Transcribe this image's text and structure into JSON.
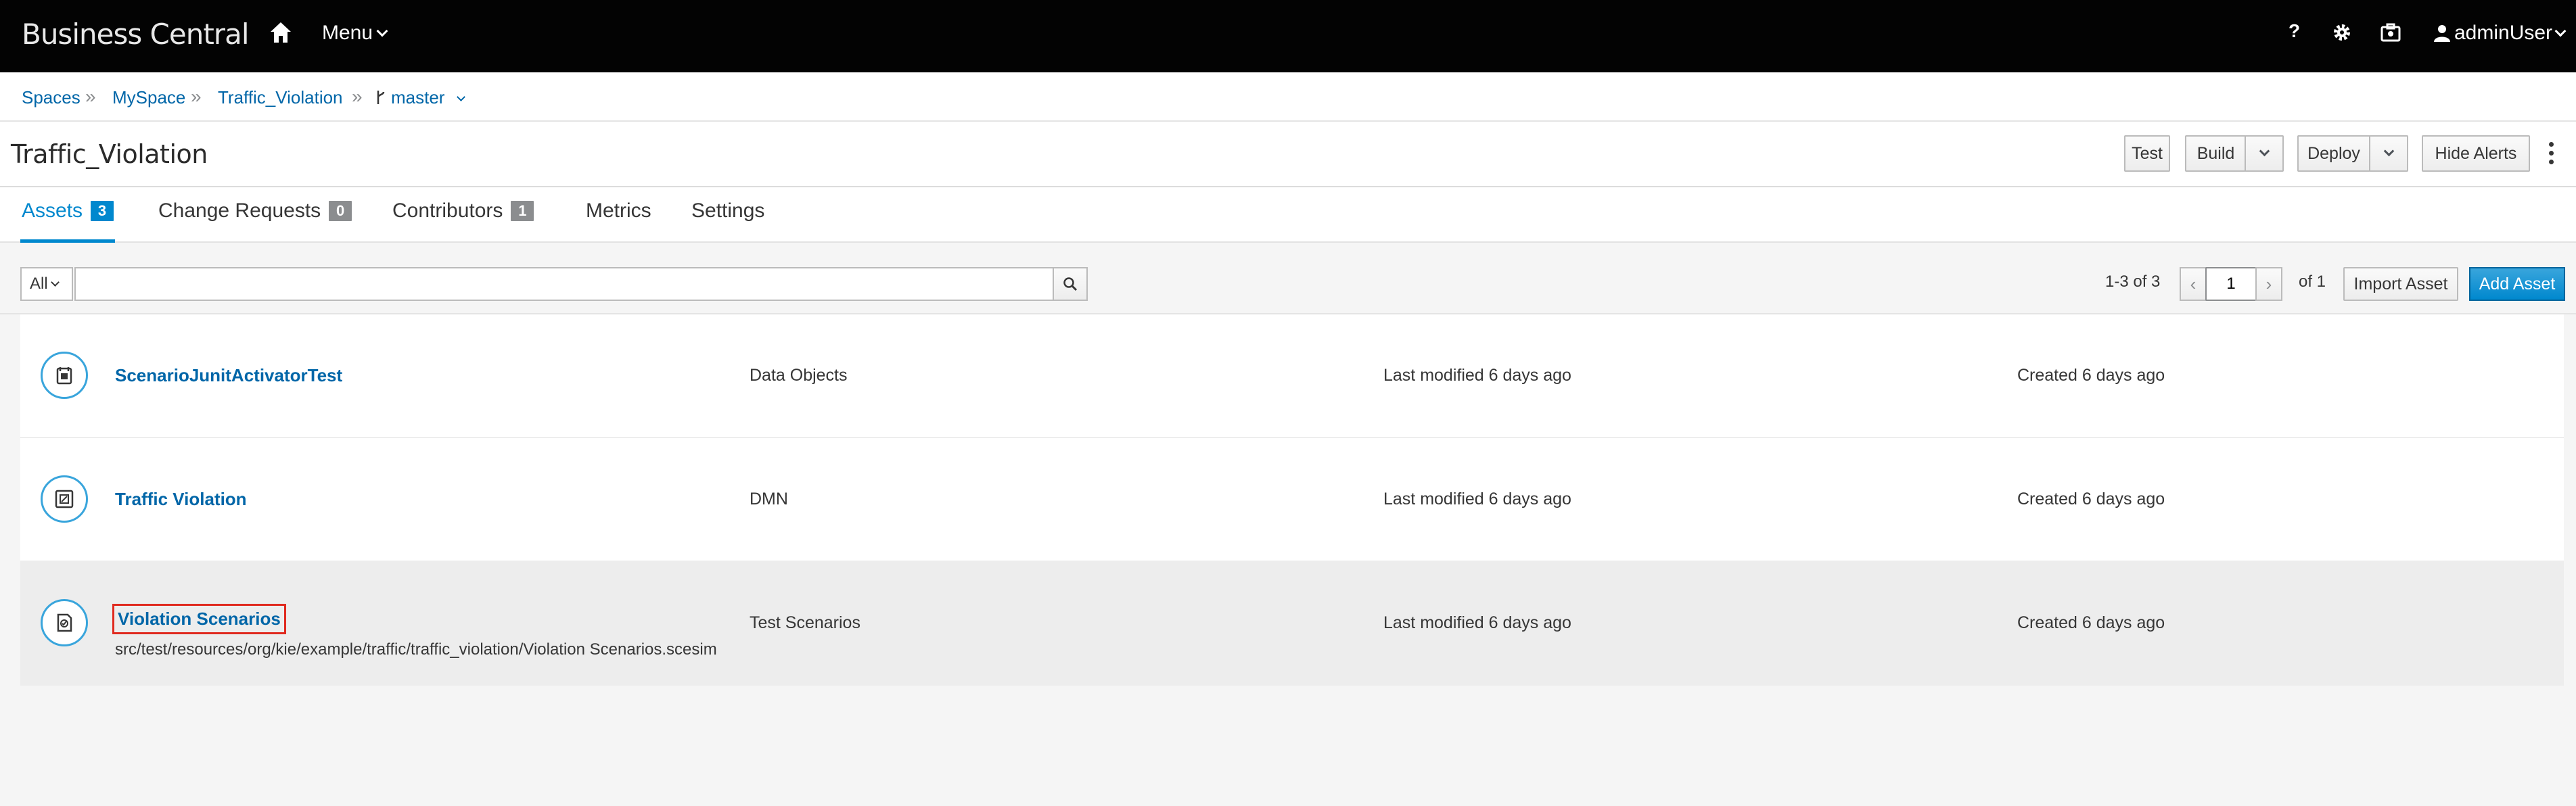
{
  "app": {
    "brand": "Business Central",
    "menu_label": "Menu",
    "help_label": "?",
    "user_label": "adminUser"
  },
  "breadcrumb": {
    "items": [
      "Spaces",
      "MySpace",
      "Traffic_Violation"
    ],
    "branch": "master"
  },
  "project": {
    "title": "Traffic_Violation",
    "buttons": {
      "test": "Test",
      "build": "Build",
      "deploy": "Deploy",
      "hide_alerts": "Hide Alerts"
    }
  },
  "tabs": [
    {
      "label": "Assets",
      "count": "3",
      "active": true
    },
    {
      "label": "Change Requests",
      "count": "0"
    },
    {
      "label": "Contributors",
      "count": "1"
    },
    {
      "label": "Metrics"
    },
    {
      "label": "Settings"
    }
  ],
  "toolbar": {
    "filter_value": "All",
    "search_value": "",
    "pager_count": "1-3 of 3",
    "page_value": "1",
    "page_of": "of 1",
    "import_label": "Import Asset",
    "add_label": "Add Asset"
  },
  "assets": [
    {
      "name": "ScenarioJunitActivatorTest",
      "type": "Data Objects",
      "modified": "Last modified 6 days ago",
      "created": "Created 6 days ago",
      "icon": "data-object-icon"
    },
    {
      "name": "Traffic Violation",
      "type": "DMN",
      "modified": "Last modified 6 days ago",
      "created": "Created 6 days ago",
      "icon": "dmn-icon"
    },
    {
      "name": "Violation Scenarios",
      "path": "src/test/resources/org/kie/example/traffic/traffic_violation/Violation Scenarios.scesim",
      "type": "Test Scenarios",
      "modified": "Last modified 6 days ago",
      "created": "Created 6 days ago",
      "icon": "test-scenario-icon"
    }
  ],
  "colors": {
    "navbar": "#030303",
    "link": "#0066a8",
    "accent": "#0088ce",
    "highlight": "#e02a1f"
  }
}
